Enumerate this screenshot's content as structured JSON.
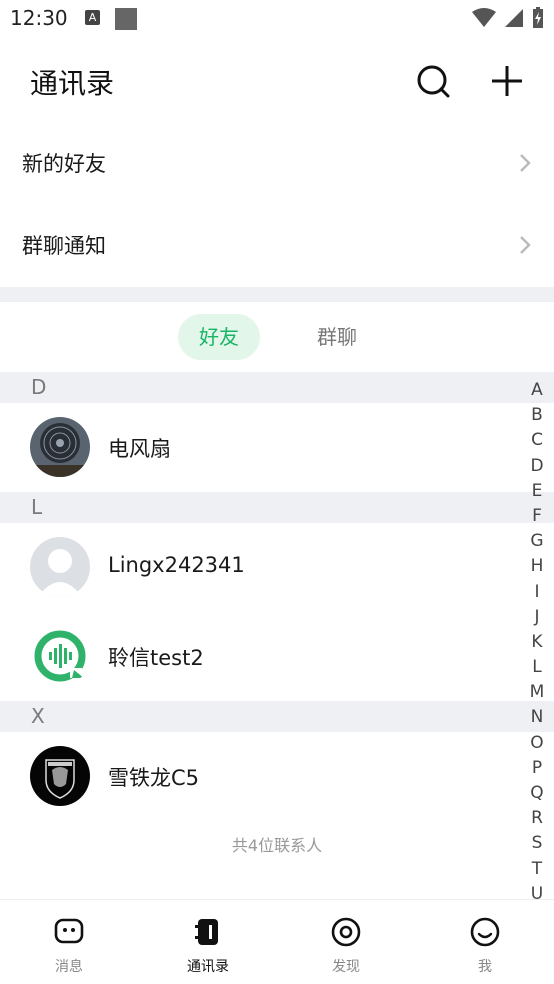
{
  "status_bar": {
    "time": "12:30",
    "notification_glyph": "A"
  },
  "header": {
    "title": "通讯录",
    "search_icon": "search-icon",
    "add_icon": "plus-icon"
  },
  "menu": [
    {
      "label": "新的好友"
    },
    {
      "label": "群聊通知"
    }
  ],
  "tabs": {
    "active": "好友",
    "inactive": "群聊"
  },
  "sections": [
    {
      "letter": "D",
      "contacts": [
        {
          "name": "电风扇",
          "avatar": "fan-photo"
        }
      ]
    },
    {
      "letter": "L",
      "contacts": [
        {
          "name": "Lingx242341",
          "avatar": "default-avatar"
        },
        {
          "name": "聆信test2",
          "avatar": "lingxin-logo"
        }
      ]
    },
    {
      "letter": "X",
      "contacts": [
        {
          "name": "雪铁龙C5",
          "avatar": "peugeot-logo"
        }
      ]
    }
  ],
  "contact_count": "共4位联系人",
  "alphabet": [
    "A",
    "B",
    "C",
    "D",
    "E",
    "F",
    "G",
    "H",
    "I",
    "J",
    "K",
    "L",
    "M",
    "N",
    "O",
    "P",
    "Q",
    "R",
    "S",
    "T",
    "U"
  ],
  "bottom_nav": [
    {
      "label": "消息",
      "icon": "chat-icon",
      "active": false
    },
    {
      "label": "通讯录",
      "icon": "contacts-icon",
      "active": true
    },
    {
      "label": "发现",
      "icon": "discover-icon",
      "active": false
    },
    {
      "label": "我",
      "icon": "smile-icon",
      "active": false
    }
  ],
  "colors": {
    "accent": "#18b566",
    "tab_active_bg": "#e3f6ea",
    "section_bg": "#eef0f4"
  }
}
